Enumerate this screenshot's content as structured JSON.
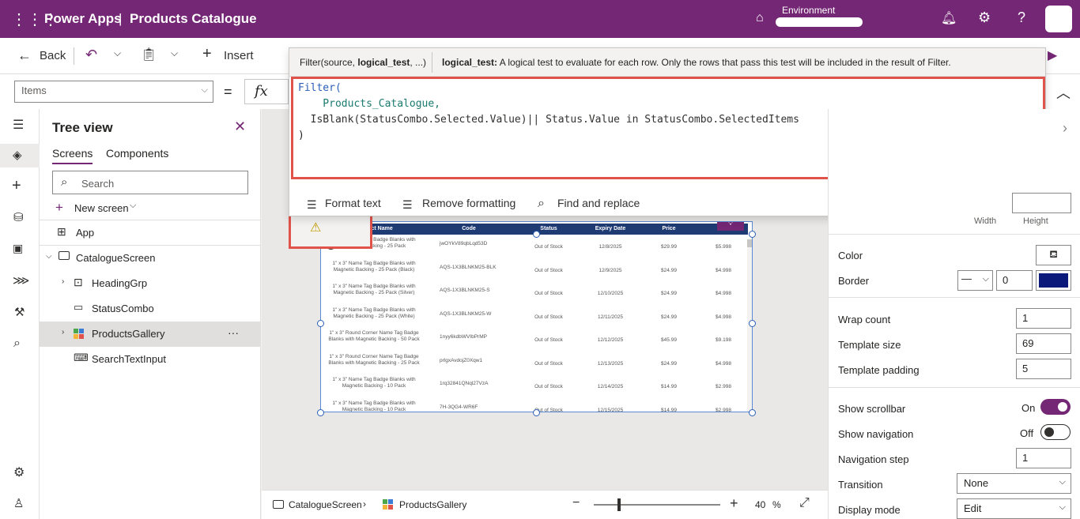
{
  "app": {
    "title": "Power Apps",
    "separator": "|",
    "name": "Products Catalogue",
    "env_label": "Environment"
  },
  "toolbar": {
    "back": "Back",
    "insert": "Insert"
  },
  "property": {
    "selected": "Items",
    "equals": "=",
    "fx": "fx"
  },
  "formula": {
    "signature_prefix": "Filter(source, ",
    "signature_bold": "logical_test",
    "signature_suffix": ", ...)",
    "param_name": "logical_test:",
    "param_desc": "A logical test to evaluate for each row. Only the rows that pass this test will be included in the result of Filter.",
    "lines": [
      "Filter(",
      "    Products_Catalogue,",
      "  IsBlank(StatusCombo.Selected.Value)|| Status.Value in StatusCombo.SelectedItems",
      ")"
    ],
    "format_text": "Format text",
    "remove_formatting": "Remove formatting",
    "find_replace": "Find and replace"
  },
  "tree": {
    "title": "Tree view",
    "tabs": [
      "Screens",
      "Components"
    ],
    "search_placeholder": "Search",
    "new_screen": "New screen",
    "items": [
      "App",
      "CatalogueScreen",
      "HeadingGrp",
      "StatusCombo",
      "ProductsGallery",
      "SearchTextInput"
    ],
    "more": "···"
  },
  "gallery": {
    "headers": [
      "Product Name",
      "Code",
      "Status",
      "Expiry Date",
      "Price",
      "Dis"
    ],
    "rows": [
      [
        "1\" x 3\" Name Tag Badge Blanks with Magnetic Backing - 25 Pack",
        "jwOYkV89qbLqd53D",
        "Out of Stock",
        "12/8/2025",
        "$29.99",
        "$5.998"
      ],
      [
        "1\" x 3\" Name Tag Badge Blanks with Magnetic Backing - 25 Pack (Black)",
        "AQS-1X3BLNKM25-BLK",
        "Out of Stock",
        "12/9/2025",
        "$24.99",
        "$4.998"
      ],
      [
        "1\" x 3\" Name Tag Badge Blanks with Magnetic Backing - 25 Pack (Silver)",
        "AQS-1X3BLNKM25-S",
        "Out of Stock",
        "12/10/2025",
        "$24.99",
        "$4.998"
      ],
      [
        "1\" x 3\" Name Tag Badge Blanks with Magnetic Backing - 25 Pack (White)",
        "AQS-1X3BLNKM25-W",
        "Out of Stock",
        "12/11/2025",
        "$24.99",
        "$4.998"
      ],
      [
        "1\" x 3\" Round Corner Name Tag Badge Blanks with Magnetic Backing - 50 Pack",
        "1nyy6kdbWVIbPrMP",
        "Out of Stock",
        "12/12/2025",
        "$45.99",
        "$9.198"
      ],
      [
        "1\" x 3\" Round Corner Name Tag Badge Blanks with Magnetic Backing - 25 Pack",
        "prlgxAvdojZ0Xqw1",
        "Out of Stock",
        "12/13/2025",
        "$24.99",
        "$4.998"
      ],
      [
        "1\" x 3\" Name Tag Badge Blanks with Magnetic Backing - 10 Pack",
        "1rq32841QNql27VzA",
        "Out of Stock",
        "12/14/2025",
        "$14.99",
        "$2.998"
      ],
      [
        "1\" x 3\" Name Tag Badge Blanks with Magnetic Backing - 10 Pack",
        "7H-3QG4-WR6F",
        "Out of Stock",
        "12/15/2025",
        "$14.99",
        "$2.998"
      ]
    ]
  },
  "right": {
    "width_label": "Width",
    "height_label": "Height",
    "color": "Color",
    "border": "Border",
    "border_value": "0",
    "wrap_count": "Wrap count",
    "wrap_value": "1",
    "template_size": "Template size",
    "template_size_value": "69",
    "template_padding": "Template padding",
    "template_padding_value": "5",
    "show_scrollbar": "Show scrollbar",
    "show_scrollbar_state": "On",
    "show_navigation": "Show navigation",
    "show_navigation_state": "Off",
    "navigation_step": "Navigation step",
    "navigation_step_value": "1",
    "transition": "Transition",
    "transition_value": "None",
    "display_mode": "Display mode",
    "display_mode_value": "Edit"
  },
  "statusbar": {
    "screen": "CatalogueScreen",
    "control": "ProductsGallery",
    "zoom": "40",
    "zoom_unit": "%"
  },
  "colors": {
    "brand": "#742774",
    "accent_red": "#e0534a",
    "border_color": "#0b1a7a",
    "gallery_header": "#1f3b73"
  }
}
